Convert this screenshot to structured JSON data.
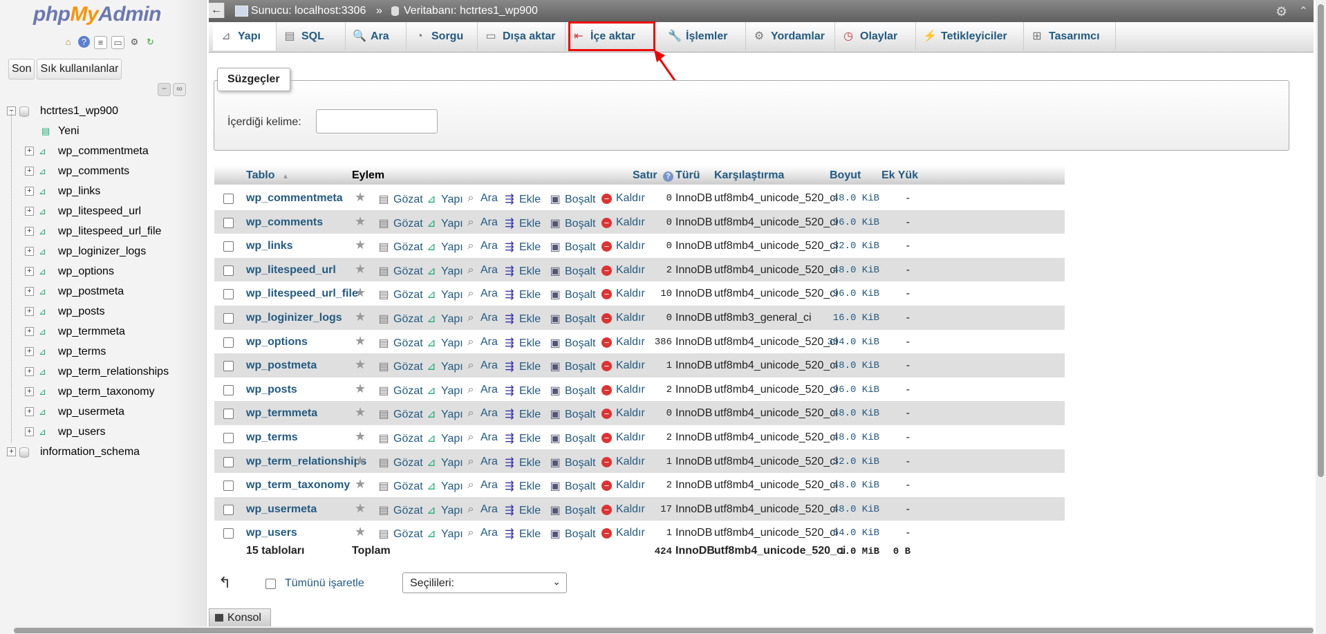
{
  "app": {
    "logo_php": "php",
    "logo_my": "My",
    "logo_admin": "Admin"
  },
  "sidebar": {
    "nav_recent": "Son",
    "nav_favorites": "Sık kullanılanlar",
    "tree": [
      {
        "label": "hctrtes1_wp900",
        "type": "database",
        "expanded": true
      },
      {
        "label": "Yeni",
        "type": "new"
      },
      {
        "label": "wp_commentmeta",
        "type": "table"
      },
      {
        "label": "wp_comments",
        "type": "table"
      },
      {
        "label": "wp_links",
        "type": "table"
      },
      {
        "label": "wp_litespeed_url",
        "type": "table"
      },
      {
        "label": "wp_litespeed_url_file",
        "type": "table"
      },
      {
        "label": "wp_loginizer_logs",
        "type": "table"
      },
      {
        "label": "wp_options",
        "type": "table"
      },
      {
        "label": "wp_postmeta",
        "type": "table"
      },
      {
        "label": "wp_posts",
        "type": "table"
      },
      {
        "label": "wp_termmeta",
        "type": "table"
      },
      {
        "label": "wp_terms",
        "type": "table"
      },
      {
        "label": "wp_term_relationships",
        "type": "table"
      },
      {
        "label": "wp_term_taxonomy",
        "type": "table"
      },
      {
        "label": "wp_usermeta",
        "type": "table"
      },
      {
        "label": "wp_users",
        "type": "table"
      },
      {
        "label": "information_schema",
        "type": "database",
        "expanded": false
      }
    ]
  },
  "topbar": {
    "server": "Sunucu: localhost:3306",
    "separator": "»",
    "database": "Veritabanı: hctrtes1_wp900"
  },
  "tabs": [
    {
      "label": "Yapı",
      "icon": "structure-icon",
      "active": true
    },
    {
      "label": "SQL",
      "icon": "sql-icon"
    },
    {
      "label": "Ara",
      "icon": "search-icon"
    },
    {
      "label": "Sorgu",
      "icon": "query-icon"
    },
    {
      "label": "Dışa aktar",
      "icon": "export-icon"
    },
    {
      "label": "İçe aktar",
      "icon": "import-icon",
      "highlighted": true
    },
    {
      "label": "İşlemler",
      "icon": "wrench-icon"
    },
    {
      "label": "Yordamlar",
      "icon": "routines-icon"
    },
    {
      "label": "Olaylar",
      "icon": "clock-icon"
    },
    {
      "label": "Tetikleyiciler",
      "icon": "triggers-icon"
    },
    {
      "label": "Tasarımcı",
      "icon": "designer-icon"
    }
  ],
  "filters": {
    "legend": "Süzgeçler",
    "keyword_label": "İçerdiği kelime:",
    "keyword_value": ""
  },
  "table": {
    "headers": {
      "table": "Tablo",
      "sort": "▲",
      "action": "Eylem",
      "rows": "Satır",
      "type": "Türü",
      "collation": "Karşılaştırma",
      "size": "Boyut",
      "overhead": "Ek Yük"
    },
    "actions": {
      "browse": "Gözat",
      "structure": "Yapı",
      "search": "Ara",
      "insert": "Ekle",
      "empty": "Boşalt",
      "drop": "Kaldır"
    },
    "rows": [
      {
        "name": "wp_commentmeta",
        "rows": "0",
        "type": "InnoDB",
        "collation": "utf8mb4_unicode_520_ci",
        "size": "48.0 KiB",
        "overhead": "-"
      },
      {
        "name": "wp_comments",
        "rows": "0",
        "type": "InnoDB",
        "collation": "utf8mb4_unicode_520_ci",
        "size": "96.0 KiB",
        "overhead": "-"
      },
      {
        "name": "wp_links",
        "rows": "0",
        "type": "InnoDB",
        "collation": "utf8mb4_unicode_520_ci",
        "size": "32.0 KiB",
        "overhead": "-"
      },
      {
        "name": "wp_litespeed_url",
        "rows": "2",
        "type": "InnoDB",
        "collation": "utf8mb4_unicode_520_ci",
        "size": "48.0 KiB",
        "overhead": "-"
      },
      {
        "name": "wp_litespeed_url_file",
        "rows": "10",
        "type": "InnoDB",
        "collation": "utf8mb4_unicode_520_ci",
        "size": "96.0 KiB",
        "overhead": "-"
      },
      {
        "name": "wp_loginizer_logs",
        "rows": "0",
        "type": "InnoDB",
        "collation": "utf8mb3_general_ci",
        "size": "16.0 KiB",
        "overhead": "-"
      },
      {
        "name": "wp_options",
        "rows": "386",
        "type": "InnoDB",
        "collation": "utf8mb4_unicode_520_ci",
        "size": "304.0 KiB",
        "overhead": "-"
      },
      {
        "name": "wp_postmeta",
        "rows": "1",
        "type": "InnoDB",
        "collation": "utf8mb4_unicode_520_ci",
        "size": "48.0 KiB",
        "overhead": "-"
      },
      {
        "name": "wp_posts",
        "rows": "2",
        "type": "InnoDB",
        "collation": "utf8mb4_unicode_520_ci",
        "size": "96.0 KiB",
        "overhead": "-"
      },
      {
        "name": "wp_termmeta",
        "rows": "0",
        "type": "InnoDB",
        "collation": "utf8mb4_unicode_520_ci",
        "size": "48.0 KiB",
        "overhead": "-"
      },
      {
        "name": "wp_terms",
        "rows": "2",
        "type": "InnoDB",
        "collation": "utf8mb4_unicode_520_ci",
        "size": "48.0 KiB",
        "overhead": "-"
      },
      {
        "name": "wp_term_relationships",
        "rows": "1",
        "type": "InnoDB",
        "collation": "utf8mb4_unicode_520_ci",
        "size": "32.0 KiB",
        "overhead": "-"
      },
      {
        "name": "wp_term_taxonomy",
        "rows": "2",
        "type": "InnoDB",
        "collation": "utf8mb4_unicode_520_ci",
        "size": "48.0 KiB",
        "overhead": "-"
      },
      {
        "name": "wp_usermeta",
        "rows": "17",
        "type": "InnoDB",
        "collation": "utf8mb4_unicode_520_ci",
        "size": "48.0 KiB",
        "overhead": "-"
      },
      {
        "name": "wp_users",
        "rows": "1",
        "type": "InnoDB",
        "collation": "utf8mb4_unicode_520_ci",
        "size": "64.0 KiB",
        "overhead": "-"
      }
    ],
    "footer": {
      "count": "15 tabloları",
      "total_label": "Toplam",
      "rows": "424",
      "type": "InnoDB",
      "collation": "utf8mb4_unicode_520_ci",
      "size": "1.0 MiB",
      "overhead": "0 B"
    }
  },
  "bulk": {
    "check_all": "Tümünü işaretle",
    "with_selected": "Seçilileri:"
  },
  "console": {
    "label": "Konsol"
  },
  "colors": {
    "link": "#235a81",
    "highlight": "#e00000",
    "row_alt": "#dfdfdf"
  }
}
